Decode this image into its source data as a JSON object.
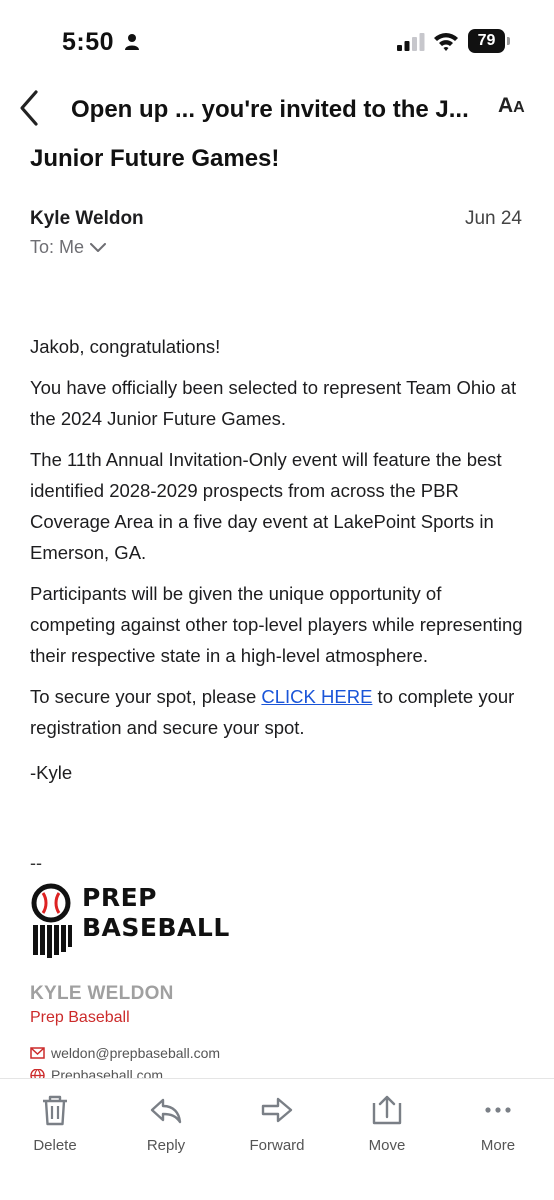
{
  "status_bar": {
    "time": "5:50",
    "battery": "79"
  },
  "header": {
    "title": "Open up ... you're invited to the J...",
    "back_icon": "chevron-left-icon",
    "font_size_label_large": "A",
    "font_size_label_small": "A"
  },
  "email": {
    "subject_continuation": "Junior Future Games!",
    "sender": "Kyle Weldon",
    "date": "Jun 24",
    "to": "To: Me",
    "body": {
      "greeting": "Jakob, congratulations!",
      "p1": "You have officially been selected to represent Team Ohio at the 2024 Junior Future Games.",
      "p2": "The 11th Annual Invitation-Only event will feature the best identified 2028-2029 prospects from across the PBR Coverage Area in a five day event at LakePoint Sports in Emerson, GA.",
      "p3": "Participants will be given the unique opportunity of competing against other top-level players while representing their respective state in a high-level atmosphere.",
      "p4_before": "To secure your spot, please ",
      "p4_link": "CLICK HERE",
      "p4_after": " to complete your registration and secure your spot.",
      "closing": "-Kyle"
    },
    "signature": {
      "dash": "--",
      "logo_line1": "PREP",
      "logo_line2": "BASEBALL",
      "name": "KYLE WELDON",
      "company": "Prep Baseball",
      "email": "weldon@prepbaseball.com",
      "website": "Prepbaseball.com"
    }
  },
  "toolbar": {
    "items": [
      {
        "label": "Delete",
        "icon": "trash-icon"
      },
      {
        "label": "Reply",
        "icon": "reply-icon"
      },
      {
        "label": "Forward",
        "icon": "forward-icon"
      },
      {
        "label": "Move",
        "icon": "move-icon"
      },
      {
        "label": "More",
        "icon": "more-icon"
      }
    ]
  },
  "colors": {
    "link": "#1a55d8",
    "signature_company": "#cc2b2b",
    "signature_name": "#a0a0a0",
    "toolbar_icon": "#7a7f86"
  }
}
